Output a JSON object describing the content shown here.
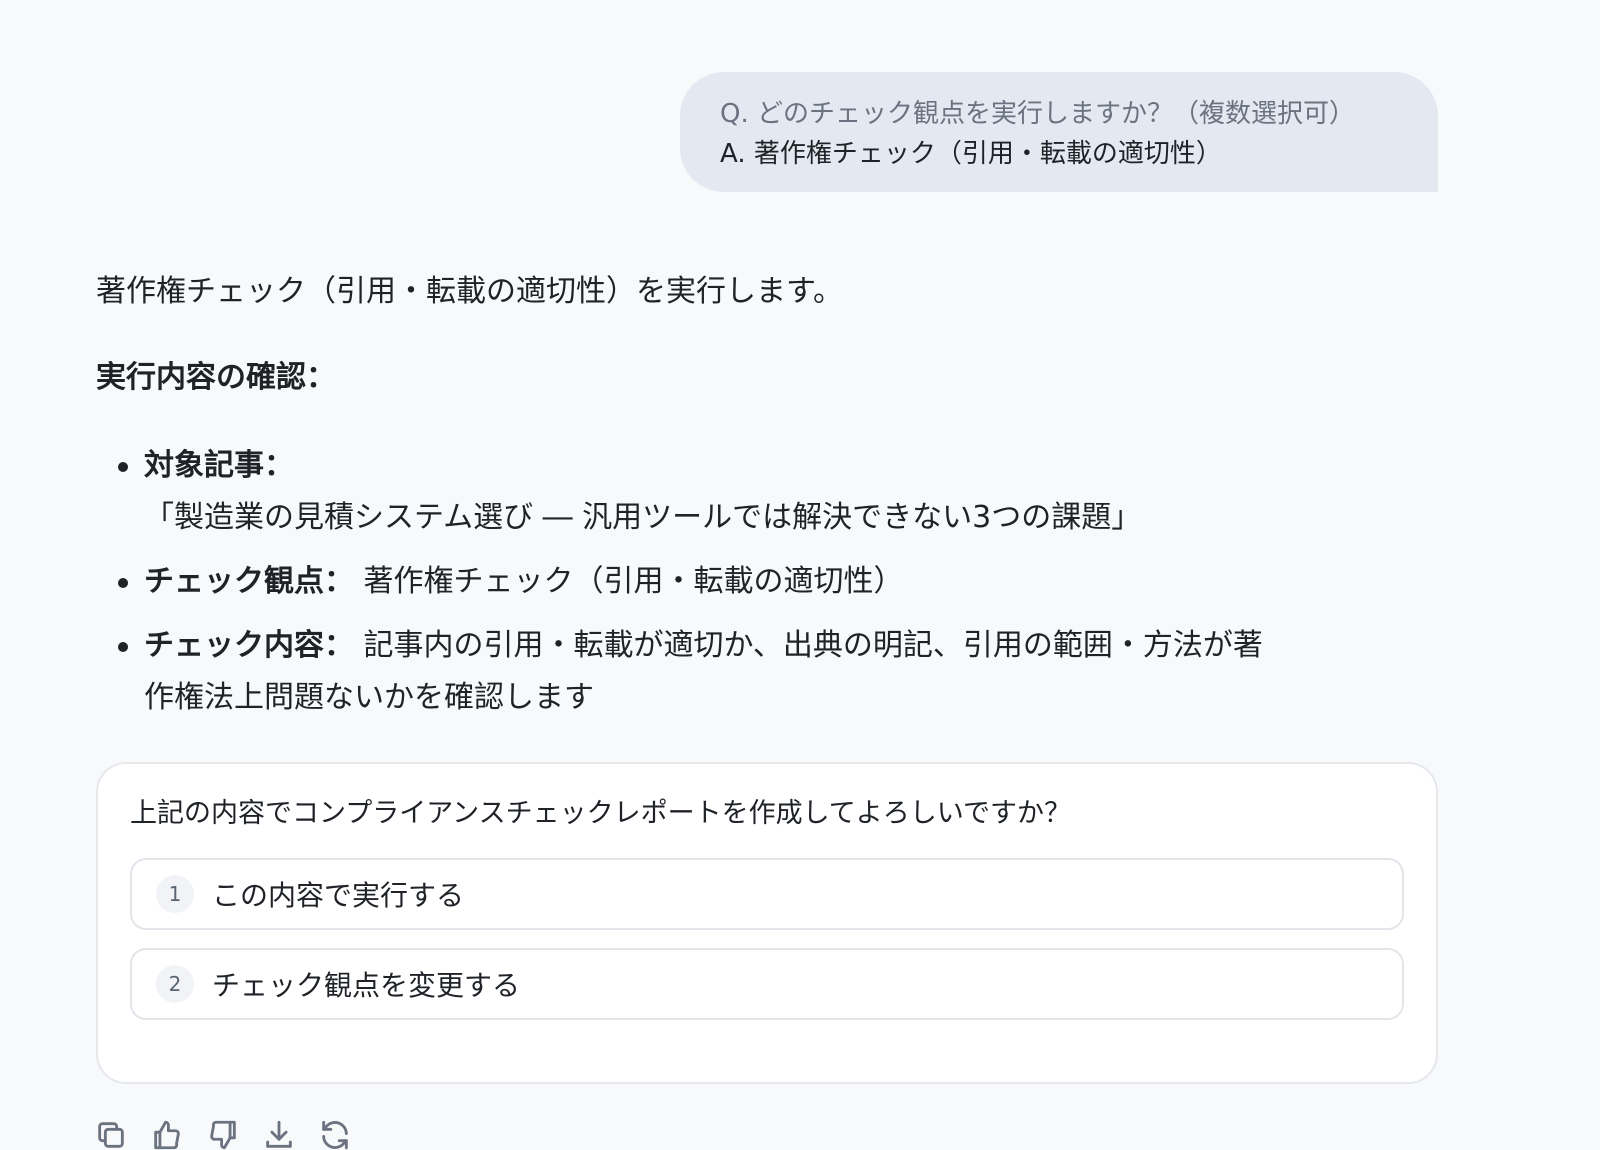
{
  "user_message": {
    "question": "Q. どのチェック観点を実行しますか？（複数選択可）",
    "answer": "A. 著作権チェック（引用・転載の適切性）"
  },
  "assistant": {
    "intro": "著作権チェック（引用・転載の適切性）を実行します。",
    "section_title": "実行内容の確認：",
    "details": [
      {
        "label": "対象記事：",
        "value": "「製造業の見積システム選び ― 汎用ツールでは解決できない3つの課題」"
      },
      {
        "label": "チェック観点：",
        "value": " 著作権チェック（引用・転載の適切性）"
      },
      {
        "label": "チェック内容：",
        "value": " 記事内の引用・転載が適切か、出典の明記、引用の範囲・方法が著作権法上問題ないかを確認します"
      }
    ]
  },
  "confirm": {
    "question": "上記の内容でコンプライアンスチェックレポートを作成してよろしいですか？",
    "options": [
      {
        "num": "1",
        "label": "この内容で実行する"
      },
      {
        "num": "2",
        "label": "チェック観点を変更する"
      }
    ]
  },
  "actions": [
    "copy-icon",
    "thumbs-up-icon",
    "thumbs-down-icon",
    "download-icon",
    "regenerate-icon"
  ]
}
